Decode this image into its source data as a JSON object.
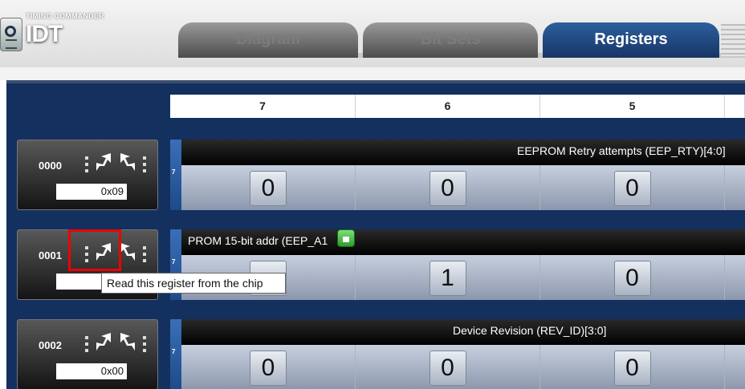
{
  "app": {
    "brand_small": "TIMING COMMANDER",
    "brand_main": "IDT"
  },
  "tabs": [
    {
      "label": "Diagram",
      "active": false
    },
    {
      "label": "Bit Sets",
      "active": false
    },
    {
      "label": "Registers",
      "active": true
    }
  ],
  "columns": [
    "7",
    "6",
    "5"
  ],
  "registers": [
    {
      "address": "0000",
      "value": "0x09",
      "field": "EEPROM Retry attempts (EEP_RTY)[4:0]",
      "bits": [
        "0",
        "0",
        "0"
      ]
    },
    {
      "address": "0001",
      "value": "0x",
      "field": "PROM 15-bit addr (EEP_A1",
      "bits": [
        "",
        "1",
        "0"
      ]
    },
    {
      "address": "0002",
      "value": "0x00",
      "field": "Device Revision (REV_ID)[3:0]",
      "bits": [
        "0",
        "0",
        "0"
      ]
    }
  ],
  "row_strip_label": "7",
  "tooltip": "Read this register from the chip",
  "colors": {
    "accent_tab": "#1f4a86",
    "main_bg": "#13305f",
    "highlight": "#e00000",
    "lock": "#3fbf3b"
  },
  "icons": [
    "read-register-icon",
    "write-register-icon",
    "unlock-icon"
  ]
}
